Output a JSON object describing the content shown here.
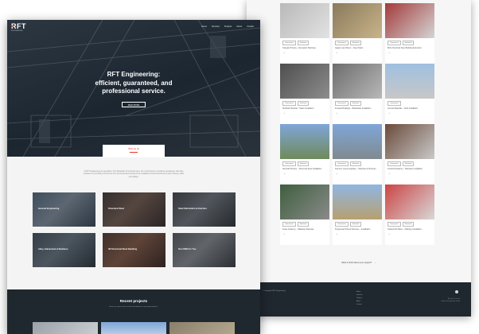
{
  "site": {
    "logo_text": "RFT",
    "logo_sub": "ENGINEERING"
  },
  "nav": [
    "Home",
    "Services",
    "Projects",
    "About",
    "Contact"
  ],
  "hero": {
    "title_lines": [
      "RFT Engineering:",
      "efficient, guaranteed, and",
      "professional service."
    ],
    "button_label": "READ MORE"
  },
  "intro": {
    "tab_label": "What we do",
    "text": "At RFT Engineering we specialise in the fabrication of structural steel. Our commitment to excellence guarantees. We pride ourselves on providing a full service from structural steel through to the installation of all structural steel, plant, flooring, stairs and railings."
  },
  "services": [
    "General Engineering",
    "Structural Steel",
    "Steel Fabrication & Erection",
    "Alloy, Galvanised & Stainless",
    "3D Structural Steel Detailing",
    "Our CDM For You"
  ],
  "recent": {
    "title": "Recent projects",
    "subtitle": "Here are some of our recent work below or view more projects."
  },
  "projects": [
    {
      "tags": [
        "Commercial",
        "Steelwork"
      ],
      "caption": "Telsgate Primary – Reception Staircase"
    },
    {
      "tags": [
        "Commercial",
        "Steelwork"
      ],
      "caption": "Jaguar Land Rover – Steel Stairs"
    },
    {
      "tags": [
        "Commercial",
        "Steelwork"
      ],
      "caption": "Brick Structural Steel Building Extension"
    },
    {
      "tags": [
        "Commercial",
        "Steelwork"
      ],
      "caption": "Sheffield Hospital – Stairs Installation"
    },
    {
      "tags": [
        "Commercial",
        "Steelwork"
      ],
      "caption": "Forward Buildings – Balustrade Installation"
    },
    {
      "tags": [
        "Commercial"
      ],
      "caption": "Ground Materials – Roof Installation"
    },
    {
      "tags": [
        "Commercial",
        "Steelwork"
      ],
      "caption": "Stonehill Primary – Structural Steel Installation"
    },
    {
      "tags": [
        "Commercial",
        "Steelwork"
      ],
      "caption": "Summer Lovely Supplies – Staircase & Structure"
    },
    {
      "tags": [
        "Commercial",
        "Steelwork"
      ],
      "caption": "Loshmill Academy – Staircase Installation"
    },
    {
      "tags": [
        "Commercial",
        "Steelwork"
      ],
      "caption": "Keele Academy – Walkway Staircase"
    },
    {
      "tags": [
        "Commercial",
        "Steelwork"
      ],
      "caption": "Kingsmead School Structure – Installation"
    },
    {
      "tags": [
        "Commercial",
        "Steelwork"
      ],
      "caption": "Chatsworth Plaza – Stairway Installation"
    }
  ],
  "back_cta": {
    "text": "Want to think about your project?",
    "arrow": "→"
  },
  "back_footer": {
    "copyright": "© Copyright RFT Engineering",
    "links": [
      "Home",
      "Services",
      "Projects",
      "About",
      "Contact"
    ],
    "right_lines": [
      "All rights reserved",
      "Website designed by Studio"
    ]
  },
  "colors": {
    "accent": "#e4322b",
    "dark": "#1f272f"
  },
  "icons": {
    "arrow": "→",
    "social": "social-icon"
  }
}
